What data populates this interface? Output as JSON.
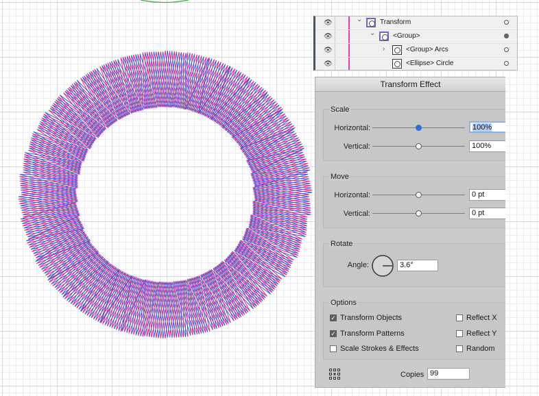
{
  "layers": [
    {
      "name": "Transform",
      "indent": 0,
      "chevron": "chevron-down",
      "selected": true,
      "target_filled": false
    },
    {
      "name": "<Group>",
      "indent": 1,
      "chevron": "chevron-down",
      "selected": true,
      "target_filled": true
    },
    {
      "name": "<Group> Arcs",
      "indent": 2,
      "chevron": "chevron-right",
      "selected": false,
      "target_filled": false
    },
    {
      "name": "<Ellipse> Circle",
      "indent": 2,
      "chevron": "",
      "selected": false,
      "target_filled": false
    }
  ],
  "dialog": {
    "title": "Transform Effect",
    "scale": {
      "title": "Scale",
      "horizontal_label": "Horizontal:",
      "horizontal_value": "100%",
      "vertical_label": "Vertical:",
      "vertical_value": "100%"
    },
    "move": {
      "title": "Move",
      "horizontal_label": "Horizontal:",
      "horizontal_value": "0 pt",
      "vertical_label": "Vertical:",
      "vertical_value": "0 pt"
    },
    "rotate": {
      "title": "Rotate",
      "angle_label": "Angle:",
      "angle_value": "3.6°"
    },
    "options": {
      "title": "Options",
      "transform_objects": {
        "label": "Transform Objects",
        "checked": true
      },
      "transform_patterns": {
        "label": "Transform Patterns",
        "checked": true
      },
      "scale_strokes": {
        "label": "Scale Strokes & Effects",
        "checked": false
      },
      "reflect_x": {
        "label": "Reflect X",
        "checked": false
      },
      "reflect_y": {
        "label": "Reflect Y",
        "checked": false
      },
      "random": {
        "label": "Random",
        "checked": false
      }
    },
    "copies_label": "Copies",
    "copies_value": "99"
  },
  "colors": {
    "stroke_pink": "#e2248a",
    "stroke_blue": "#3f5bd6",
    "layer_color": "#e03fb6",
    "accent": "#2f6fd6"
  },
  "icons": [
    "eye-icon",
    "chevron-down-icon",
    "chevron-right-icon",
    "reference-point-icon",
    "angle-dial-icon"
  ]
}
